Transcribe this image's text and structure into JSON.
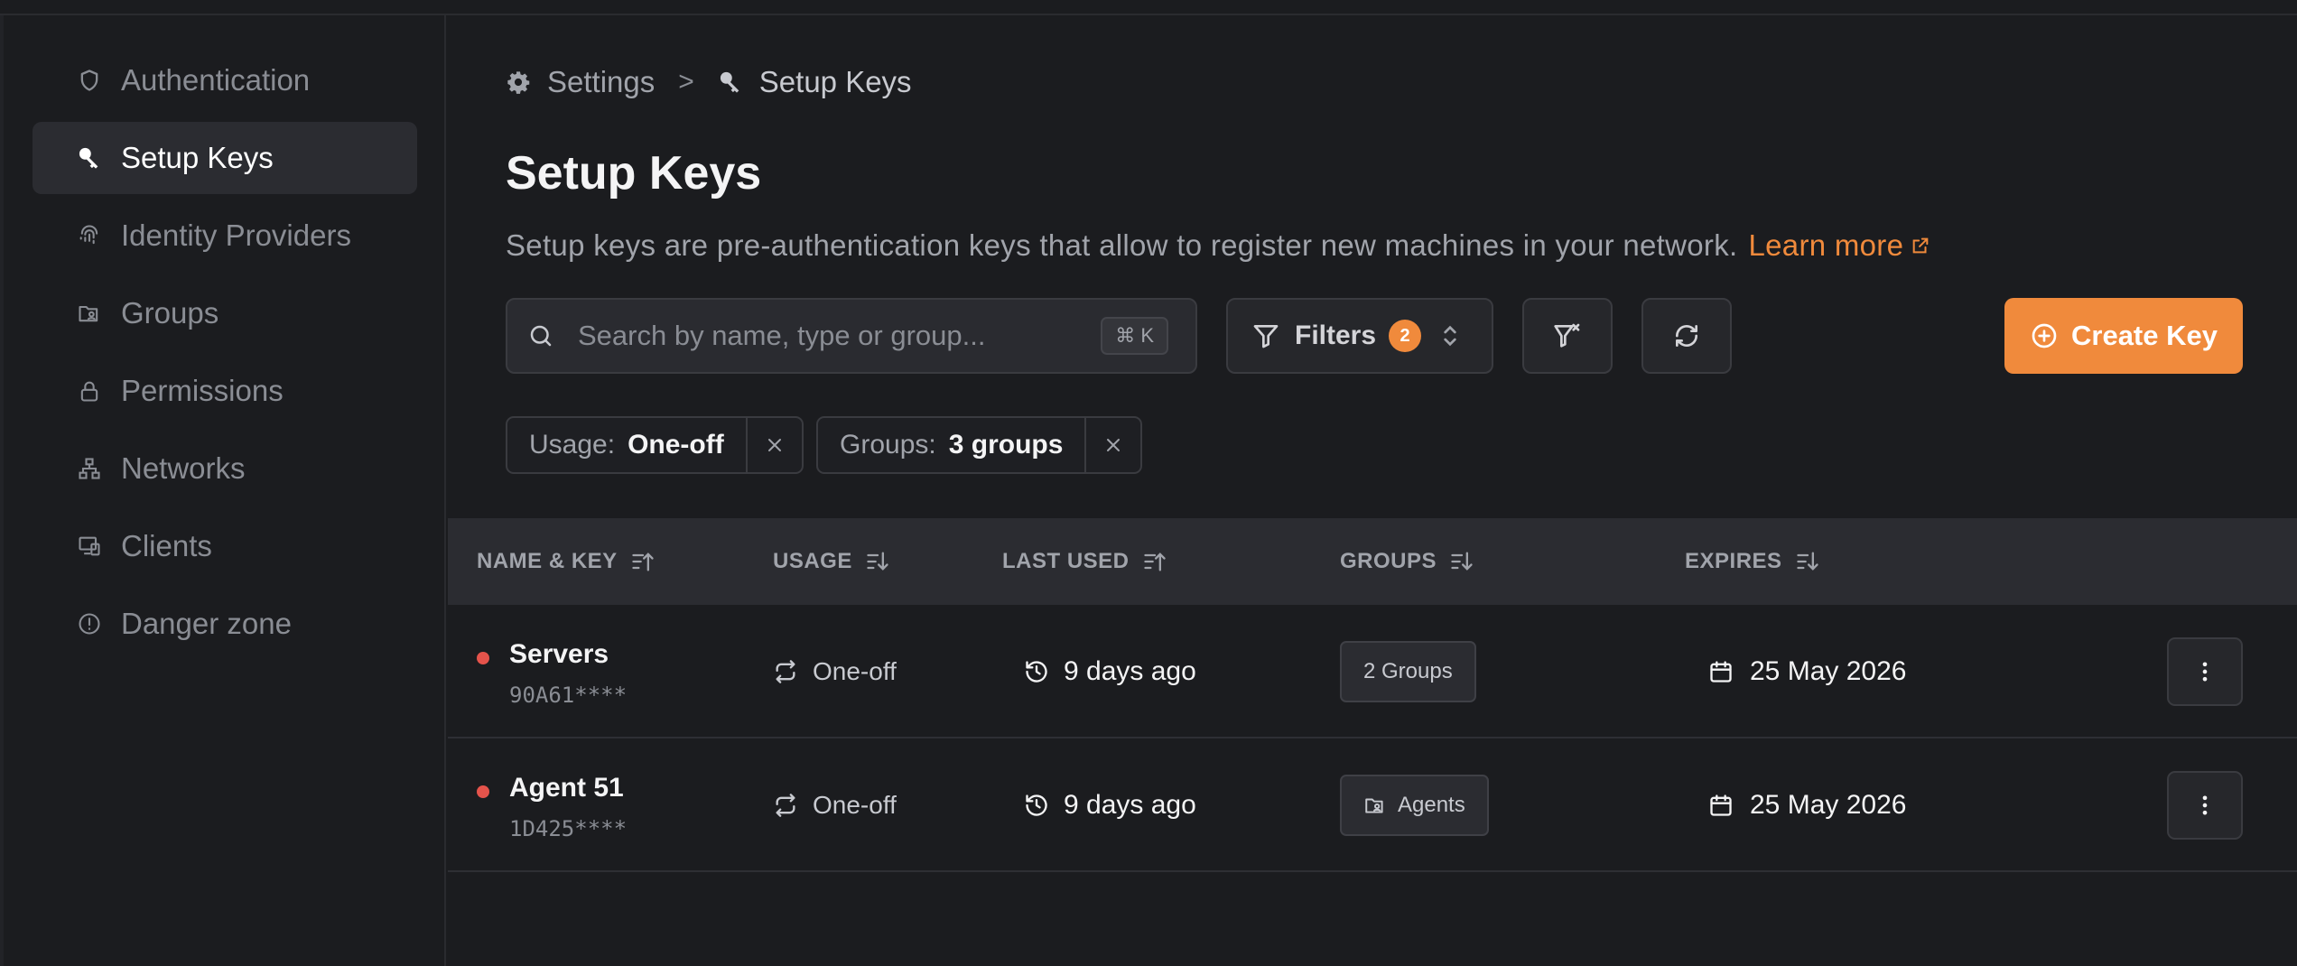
{
  "sidebar": {
    "items": [
      {
        "label": "Authentication",
        "icon": "shield-icon"
      },
      {
        "label": "Setup Keys",
        "icon": "key-icon",
        "active": true
      },
      {
        "label": "Identity Providers",
        "icon": "fingerprint-icon"
      },
      {
        "label": "Groups",
        "icon": "folder-users-icon"
      },
      {
        "label": "Permissions",
        "icon": "lock-icon"
      },
      {
        "label": "Networks",
        "icon": "network-icon"
      },
      {
        "label": "Clients",
        "icon": "devices-icon"
      },
      {
        "label": "Danger zone",
        "icon": "alert-circle-icon"
      }
    ]
  },
  "breadcrumb": {
    "root": "Settings",
    "separator": ">",
    "current": "Setup Keys"
  },
  "page": {
    "title": "Setup Keys",
    "description": "Setup keys are pre-authentication keys that allow to register new machines in your network.",
    "learn_more": "Learn more"
  },
  "toolbar": {
    "search_placeholder": "Search by name, type or group...",
    "search_shortcut": "⌘ K",
    "filters_label": "Filters",
    "filters_count": "2",
    "create_label": "Create Key"
  },
  "active_filters": [
    {
      "label": "Usage:",
      "value": "One-off"
    },
    {
      "label": "Groups:",
      "value": "3 groups"
    }
  ],
  "table": {
    "columns": [
      "NAME & KEY",
      "USAGE",
      "LAST USED",
      "GROUPS",
      "EXPIRES"
    ],
    "rows": [
      {
        "name": "Servers",
        "key": "90A61****",
        "usage": "One-off",
        "last_used": "9 days ago",
        "groups": "2 Groups",
        "expires": "25 May 2026"
      },
      {
        "name": "Agent 51",
        "key": "1D425****",
        "usage": "One-off",
        "last_used": "9 days ago",
        "groups": "Agents",
        "expires": "25 May 2026"
      }
    ]
  },
  "colors": {
    "accent": "#f08a3c",
    "background": "#1b1c1f",
    "status_dot": "#e5534b"
  }
}
